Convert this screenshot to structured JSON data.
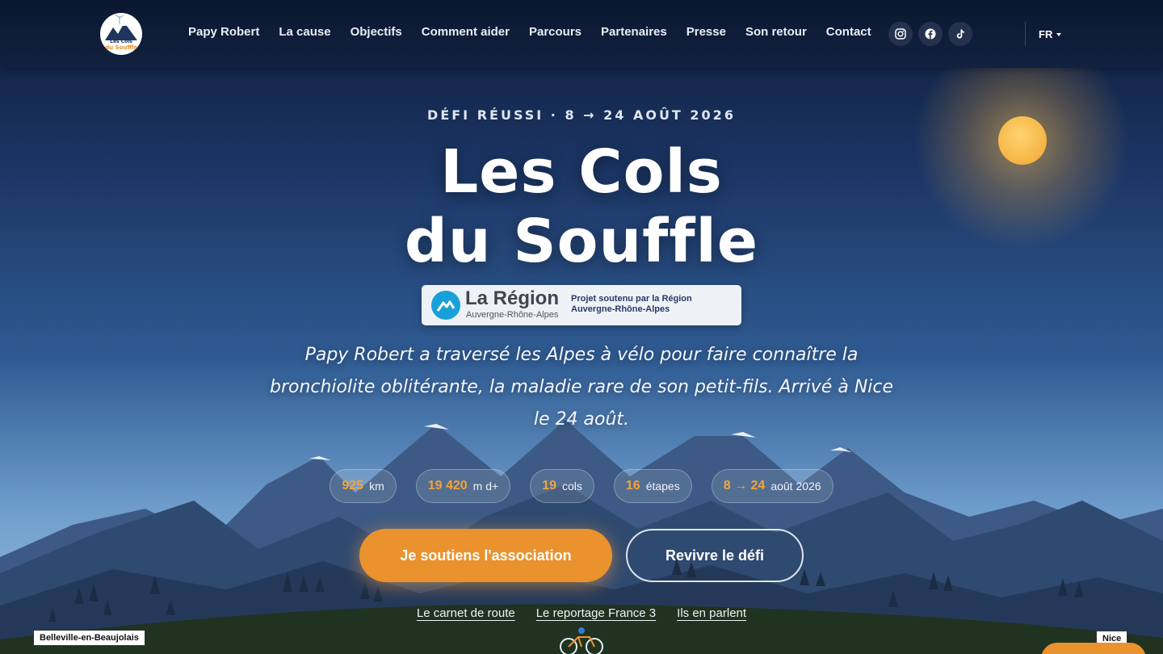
{
  "header": {
    "logo": {
      "line1": "Les Cols",
      "line2": "du Souffle"
    },
    "nav": [
      {
        "label": "Papy Robert"
      },
      {
        "label": "La cause"
      },
      {
        "label": "Objectifs"
      },
      {
        "label": "Comment aider"
      },
      {
        "label": "Parcours"
      },
      {
        "label": "Partenaires"
      },
      {
        "label": "Presse"
      },
      {
        "label": "Son retour"
      },
      {
        "label": "Contact"
      }
    ],
    "socials": [
      {
        "icon": "instagram-icon"
      },
      {
        "icon": "facebook-icon"
      },
      {
        "icon": "tiktok-icon"
      }
    ],
    "language": "FR"
  },
  "hero": {
    "eyebrow": "DÉFI RÉUSSI · 8 → 24 AOÛT 2026",
    "title_line1": "Les Cols",
    "title_line2": "du Souffle",
    "region": {
      "name": "La Région",
      "sub": "Auvergne-Rhône-Alpes",
      "note_line1": "Projet soutenu par la Région",
      "note_line2": "Auvergne-Rhône-Alpes"
    },
    "tagline": "Papy Robert a traversé les Alpes à vélo pour faire connaître la bronchiolite oblitérante, la maladie rare de son petit-fils. Arrivé à Nice le 24 août.",
    "stats": [
      {
        "value": "925",
        "unit": "km"
      },
      {
        "value": "19 420",
        "unit": "m d+"
      },
      {
        "value": "19",
        "unit": "cols"
      },
      {
        "value": "16",
        "unit": "étapes"
      },
      {
        "value": "8 → 24",
        "unit": "août 2026"
      }
    ],
    "primary_cta": "Je soutiens l'association",
    "secondary_cta": "Revivre le défi",
    "links": [
      {
        "label": "Le carnet de route"
      },
      {
        "label": "Le reportage France 3"
      },
      {
        "label": "Ils en parlent"
      }
    ]
  },
  "route": {
    "start": "Belleville-en-Beaujolais",
    "end": "Nice"
  },
  "colors": {
    "accent": "#ea922e",
    "header_bg": "#0b1730",
    "sky_top": "#1b3463",
    "sky_bottom": "#9fc2e3",
    "region_blue": "#1aa0d8"
  }
}
